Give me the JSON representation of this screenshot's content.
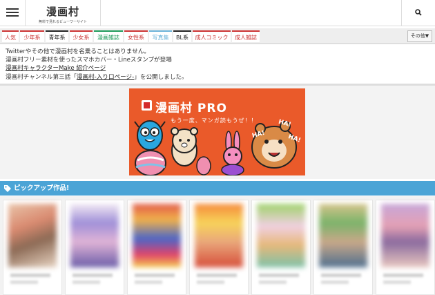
{
  "header": {
    "logo_name": "漫画村",
    "logo_tagline": "無料で見れるビューワーサイト",
    "menu_icon": "hamburger-icon",
    "search_icon": "search-icon"
  },
  "nav": {
    "tabs": [
      {
        "label": "人気",
        "color": "#c33"
      },
      {
        "label": "少年系",
        "color": "#c33"
      },
      {
        "label": "青年系",
        "color": "#222"
      },
      {
        "label": "少女系",
        "color": "#c33"
      },
      {
        "label": "漫画雑誌",
        "color": "#1e9a5a"
      },
      {
        "label": "女性系",
        "color": "#c33"
      },
      {
        "label": "写真集",
        "color": "#6bb3d9"
      },
      {
        "label": "BL系",
        "color": "#222"
      },
      {
        "label": "成人コミック",
        "color": "#c33"
      },
      {
        "label": "成人雑誌",
        "color": "#c33"
      }
    ],
    "more_label": "その他▼"
  },
  "notice": {
    "line1": "Twitterやその他で漫画村を名乗ることはありません。",
    "line2": "漫画村フリー素材を使ったスマホカバー・Lineスタンプが登場",
    "line3_link": "漫画村キャラクターMake 紹介ページ",
    "line4_prefix": "漫画村チャンネル第三話「",
    "line4_link": "漫画村-入り口ページ-",
    "line4_suffix": "」を公開しました。"
  },
  "banner": {
    "title": "漫画村 PRO",
    "subtitle": "もう一度、マンガ読もうぜ！！",
    "shout1": "HA!",
    "shout2": "HA!",
    "shout3": "HA!",
    "colors": {
      "background": "#ea5a2a"
    }
  },
  "pickup": {
    "title": "ピックアップ作品!",
    "icon": "tag-icon",
    "accent": "#4ba4d6",
    "items": [
      {
        "name": "pickup-item-1"
      },
      {
        "name": "pickup-item-2"
      },
      {
        "name": "pickup-item-3"
      },
      {
        "name": "pickup-item-4"
      },
      {
        "name": "pickup-item-5"
      },
      {
        "name": "pickup-item-6"
      },
      {
        "name": "pickup-item-7"
      }
    ]
  }
}
